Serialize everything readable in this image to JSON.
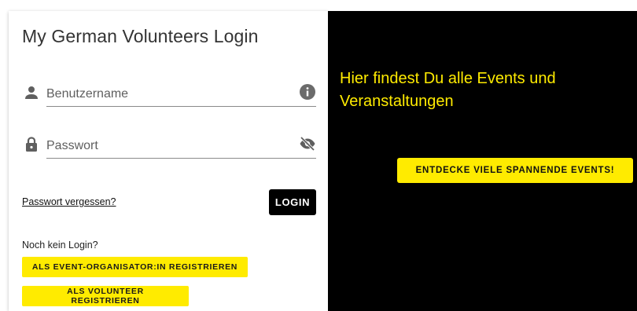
{
  "login": {
    "title": "My German Volunteers Login",
    "username": {
      "placeholder": "Benutzername",
      "value": "",
      "icon": "person-icon",
      "trailing_icon": "info-icon"
    },
    "password": {
      "placeholder": "Passwort",
      "value": "",
      "icon": "lock-icon",
      "trailing_icon": "visibility-off-icon"
    },
    "forgot_password": "Passwort vergessen?",
    "login_button": "LOGIN",
    "no_login_text": "Noch kein Login?",
    "register_organizer": "ALS EVENT-ORGANISATOR:IN REGISTRIEREN",
    "register_volunteer": "ALS VOLUNTEER REGISTRIEREN"
  },
  "hero": {
    "text": "Hier findest Du alle Events und Veranstaltungen",
    "button": "ENTDECKE VIELE SPANNENDE EVENTS!"
  },
  "colors": {
    "accent_yellow": "#ffeb00",
    "hero_background": "#000000",
    "login_button": "#000000"
  }
}
